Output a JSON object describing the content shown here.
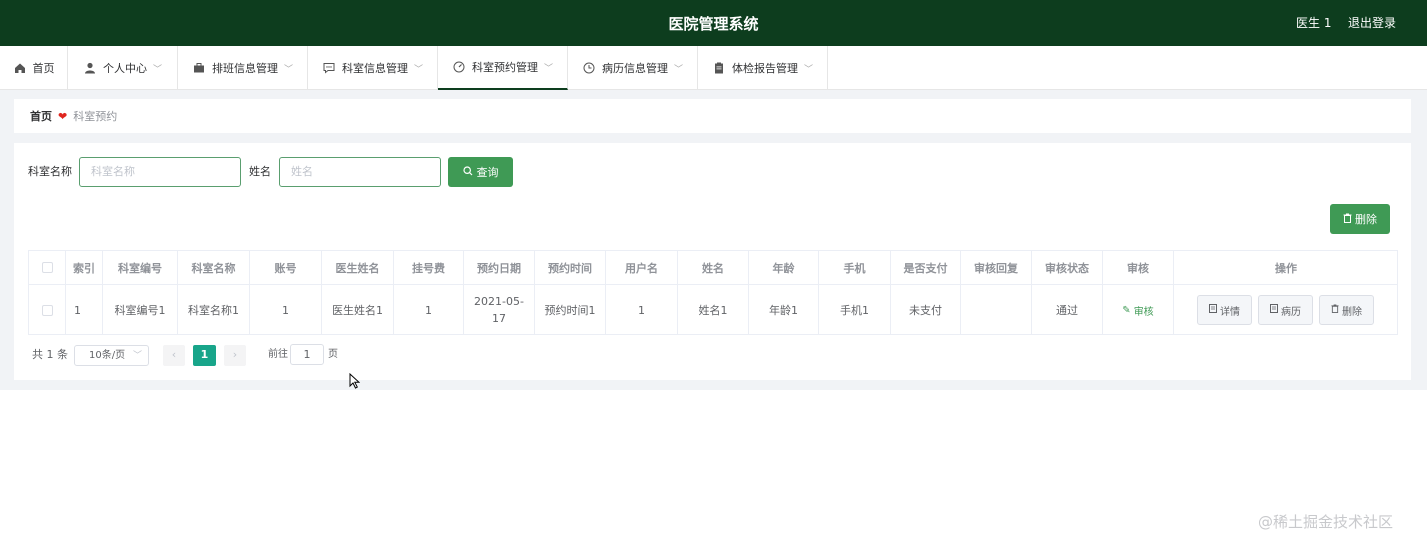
{
  "header": {
    "title": "医院管理系统",
    "user": "医生 1",
    "logout": "退出登录"
  },
  "nav": [
    {
      "label": "首页",
      "icon": "home-icon"
    },
    {
      "label": "个人中心",
      "icon": "user-icon"
    },
    {
      "label": "排班信息管理",
      "icon": "briefcase-icon"
    },
    {
      "label": "科室信息管理",
      "icon": "chat-icon"
    },
    {
      "label": "科室预约管理",
      "icon": "dashboard-icon"
    },
    {
      "label": "病历信息管理",
      "icon": "clock-icon"
    },
    {
      "label": "体检报告管理",
      "icon": "clipboard-icon"
    }
  ],
  "breadcrumb": {
    "home": "首页",
    "current": "科室预约"
  },
  "search": {
    "dept_label": "科室名称",
    "dept_placeholder": "科室名称",
    "name_label": "姓名",
    "name_placeholder": "姓名",
    "query": "查询"
  },
  "delete_btn": "删除",
  "table": {
    "headers": [
      "索引",
      "科室编号",
      "科室名称",
      "账号",
      "医生姓名",
      "挂号费",
      "预约日期",
      "预约时间",
      "用户名",
      "姓名",
      "年龄",
      "手机",
      "是否支付",
      "审核回复",
      "审核状态",
      "审核",
      "操作"
    ],
    "row": [
      "1",
      "科室编号1",
      "科室名称1",
      "1",
      "医生姓名1",
      "1",
      "2021-05-17",
      "预约时间1",
      "1",
      "姓名1",
      "年龄1",
      "手机1",
      "未支付",
      "",
      "通过"
    ],
    "audit": "审核",
    "ops": {
      "detail": "详情",
      "record": "病历",
      "delete": "删除"
    }
  },
  "pagination": {
    "total": "共 1 条",
    "size": "10条/页",
    "page": "1",
    "goto": "前往",
    "goto_value": "1",
    "unit": "页"
  },
  "watermark": "@稀土掘金技术社区",
  "colors": {
    "header": "#0d3d1e",
    "accent": "#3f9a55",
    "page_active": "#18a58a"
  }
}
